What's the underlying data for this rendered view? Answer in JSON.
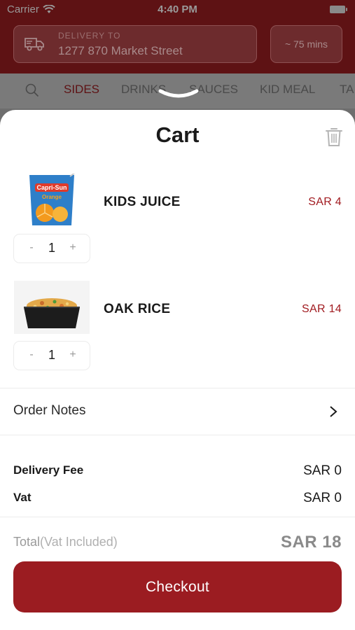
{
  "status_bar": {
    "carrier": "Carrier",
    "time": "4:40 PM"
  },
  "header": {
    "delivery_label": "DELIVERY TO",
    "delivery_address": "1277 870 Market Street",
    "eta": "~ 75 mins"
  },
  "category_tabs": [
    {
      "label": "SIDES",
      "active": true
    },
    {
      "label": "DRINKS",
      "active": false
    },
    {
      "label": "SAUCES",
      "active": false
    },
    {
      "label": "KID MEAL",
      "active": false
    },
    {
      "label": "TA",
      "active": false
    }
  ],
  "cart": {
    "title": "Cart",
    "items": [
      {
        "name": "KIDS JUICE",
        "price": "SAR 4",
        "quantity": "1",
        "image": "juice-pouch"
      },
      {
        "name": "OAK RICE",
        "price": "SAR 14",
        "quantity": "1",
        "image": "rice-bowl"
      }
    ],
    "stepper": {
      "minus": "-",
      "plus": "+"
    },
    "order_notes_label": "Order Notes",
    "fees": [
      {
        "label": "Delivery Fee",
        "value": "SAR 0"
      },
      {
        "label": "Vat",
        "value": "SAR 0"
      }
    ],
    "total_label": "Total",
    "total_suffix": "(Vat Included)",
    "total_value": "SAR 18",
    "checkout_label": "Checkout"
  },
  "colors": {
    "brand": "#9b1c21",
    "price": "#a11b20",
    "header_dimmed": "#5e1214"
  },
  "icons": [
    "wifi-icon",
    "battery-icon",
    "truck-icon",
    "search-icon",
    "grabber-icon",
    "trash-icon",
    "chevron-right-icon"
  ]
}
